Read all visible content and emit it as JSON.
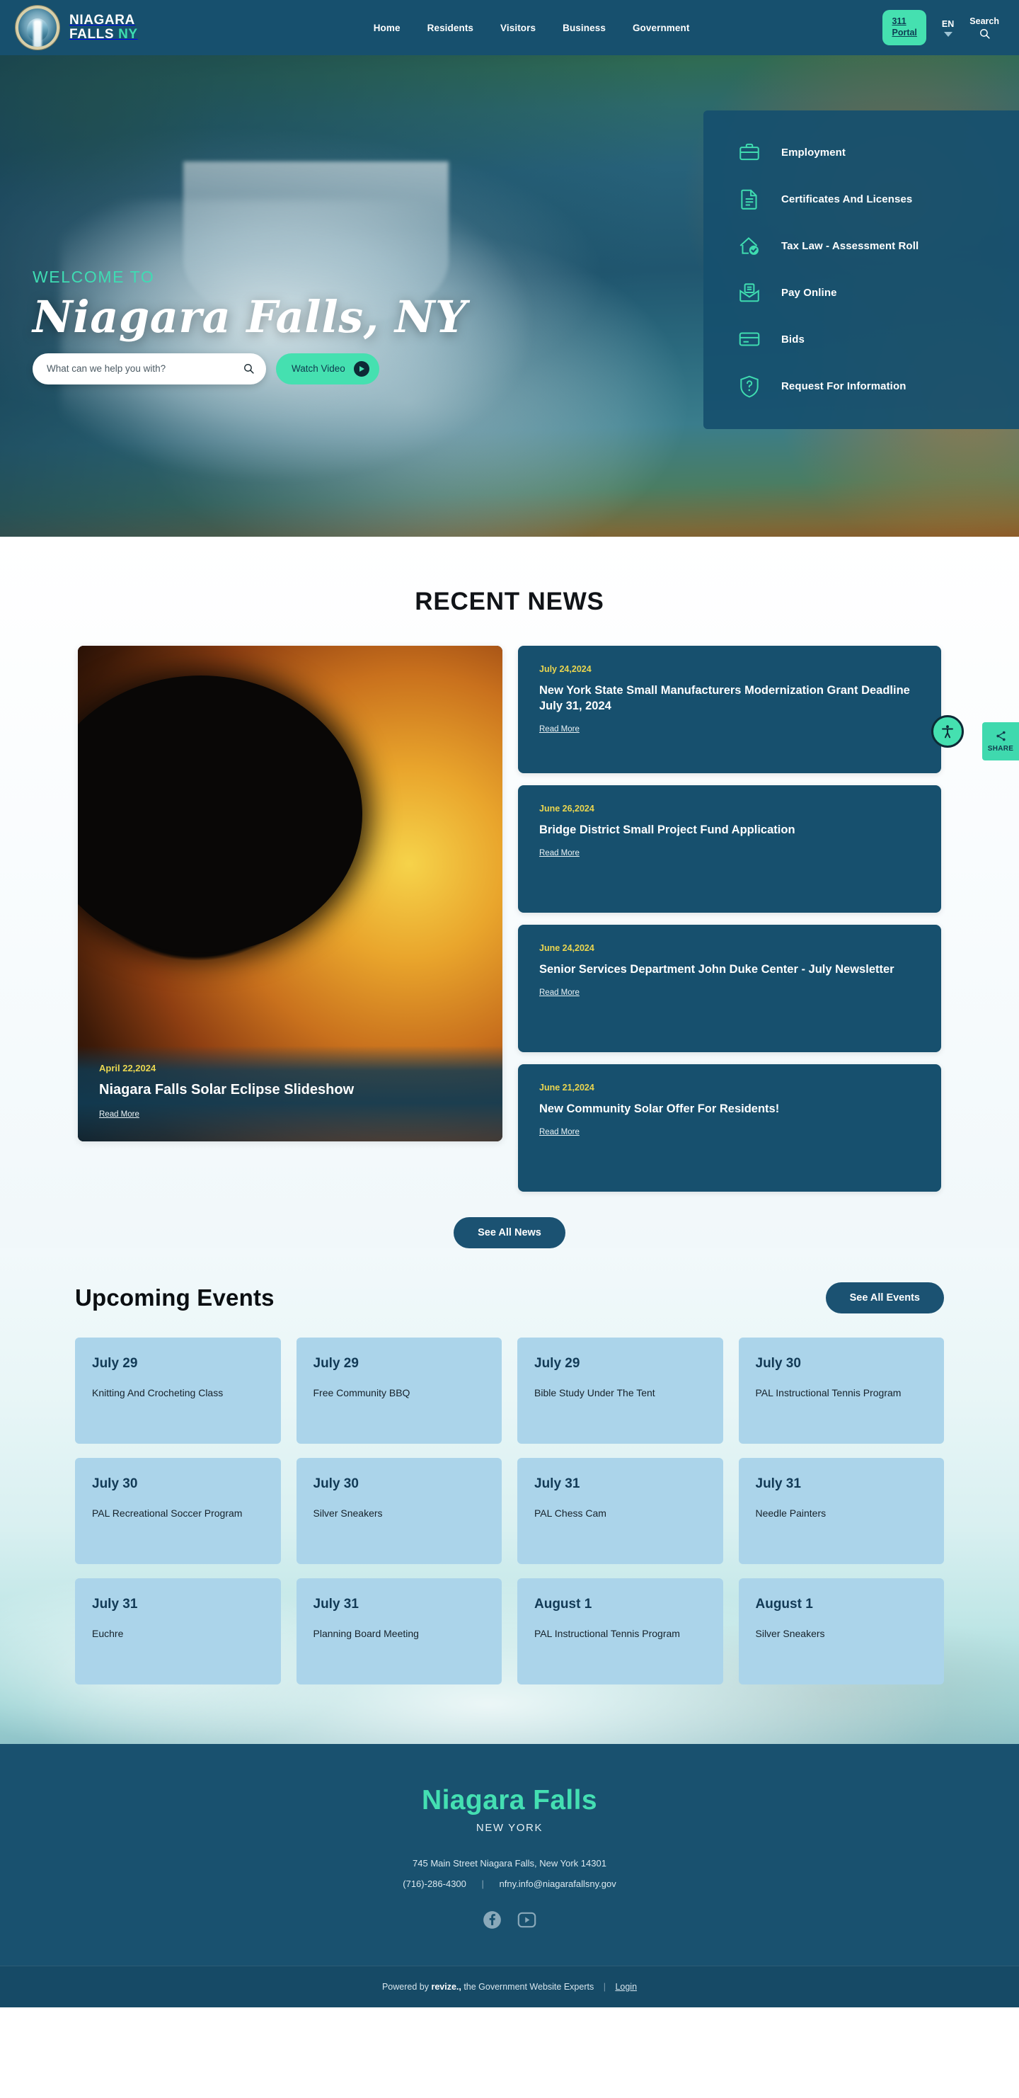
{
  "header": {
    "brand_line1": "NIAGARA",
    "brand_line2": "FALLS",
    "brand_suffix": "NY",
    "nav": [
      {
        "label": "Home"
      },
      {
        "label": "Residents"
      },
      {
        "label": "Visitors"
      },
      {
        "label": "Business"
      },
      {
        "label": "Government"
      }
    ],
    "portal_line1": "311",
    "portal_line2": "Portal",
    "language": "EN",
    "search_label": "Search"
  },
  "hero": {
    "eyebrow": "WELCOME TO",
    "title": "Niagara Falls, NY",
    "search_placeholder": "What can we help you with?",
    "search_value": "",
    "watch_video": "Watch Video"
  },
  "quicklinks": [
    {
      "label": "Employment",
      "icon": "briefcase-icon"
    },
    {
      "label": "Certificates And Licenses",
      "icon": "document-icon"
    },
    {
      "label": "Tax Law - Assessment Roll",
      "icon": "house-check-icon"
    },
    {
      "label": "Pay Online",
      "icon": "envelope-payment-icon"
    },
    {
      "label": "Bids",
      "icon": "credit-card-icon"
    },
    {
      "label": "Request For Information",
      "icon": "shield-question-icon"
    }
  ],
  "news": {
    "section_title": "RECENT NEWS",
    "read_more": "Read More",
    "see_all": "See All News",
    "featured": {
      "date": "April 22,2024",
      "title": "Niagara Falls Solar Eclipse Slideshow",
      "read_more": "Read More"
    },
    "items": [
      {
        "date": "July 24,2024",
        "title": "New York State Small Manufacturers Modernization Grant Deadline July 31, 2024",
        "read_more": "Read More"
      },
      {
        "date": "June 26,2024",
        "title": "Bridge District Small Project Fund Application",
        "read_more": "Read More"
      },
      {
        "date": "June 24,2024",
        "title": "Senior Services Department John Duke Center - July Newsletter",
        "read_more": "Read More"
      },
      {
        "date": "June 21,2024",
        "title": "New Community Solar Offer For  Residents!",
        "read_more": "Read More"
      }
    ]
  },
  "share_widget": {
    "label": "SHARE"
  },
  "events": {
    "section_title": "Upcoming Events",
    "see_all": "See All Events",
    "items": [
      {
        "date": "July 29",
        "name": "Knitting And Crocheting Class"
      },
      {
        "date": "July 29",
        "name": "Free Community BBQ"
      },
      {
        "date": "July 29",
        "name": "Bible Study Under The Tent"
      },
      {
        "date": "July 30",
        "name": "PAL Instructional Tennis Program"
      },
      {
        "date": "July 30",
        "name": "PAL Recreational Soccer Program"
      },
      {
        "date": "July 30",
        "name": "Silver Sneakers"
      },
      {
        "date": "July 31",
        "name": "PAL Chess Cam"
      },
      {
        "date": "July 31",
        "name": "Needle Painters"
      },
      {
        "date": "July 31",
        "name": "Euchre"
      },
      {
        "date": "July 31",
        "name": "Planning Board Meeting"
      },
      {
        "date": "August 1",
        "name": "PAL Instructional Tennis Program"
      },
      {
        "date": "August 1",
        "name": "Silver Sneakers"
      }
    ]
  },
  "footer": {
    "city": "Niagara Falls",
    "state": "NEW YORK",
    "address": "745 Main Street  Niagara Falls, New York 14301",
    "phone": "(716)-286-4300",
    "email": "nfny.info@niagarafallsny.gov",
    "separator": "|",
    "bar_prefix": "Powered by",
    "bar_brand": "revize.,",
    "bar_suffix": "the Government Website Experts",
    "bar_sep": "|",
    "login": "Login"
  },
  "colors": {
    "header_navy": "#17506e",
    "mint": "#45e0b0",
    "yellow_date": "#ead54f",
    "event_blue": "#abd4ea"
  }
}
